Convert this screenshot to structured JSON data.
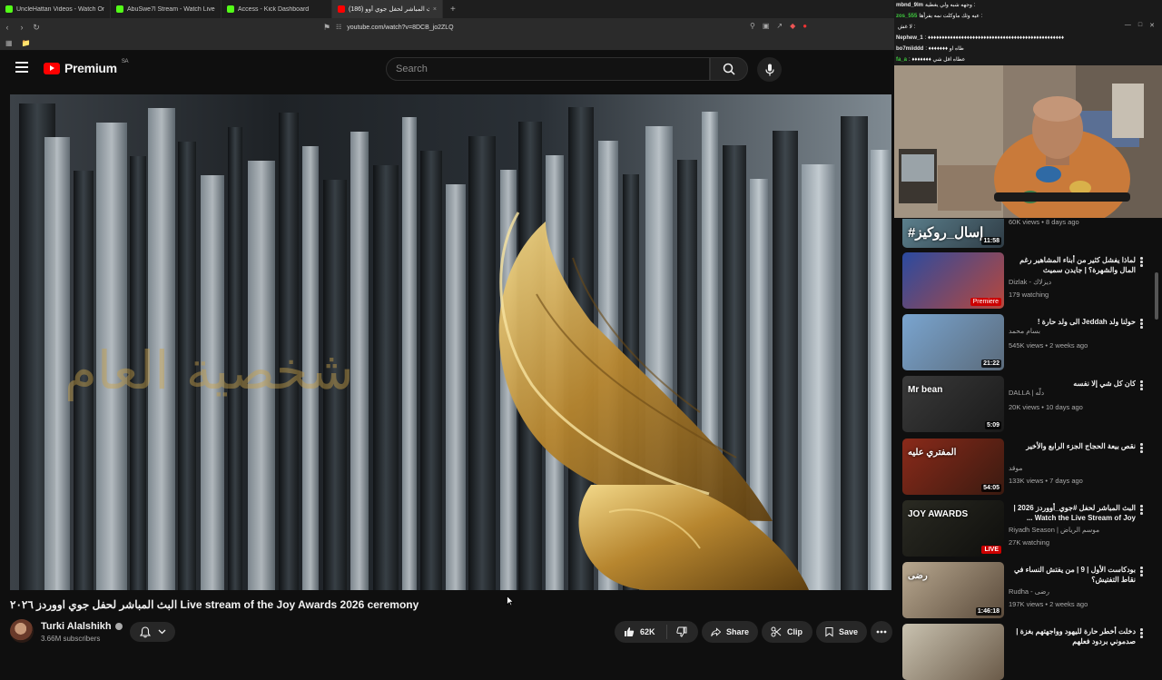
{
  "browser": {
    "tabs": [
      {
        "label": "UncleHattan Videos - Watch On",
        "icon": "kick-favicon",
        "active": false
      },
      {
        "label": "AbuSwe7l Stream - Watch Live o",
        "icon": "kick-favicon",
        "active": false
      },
      {
        "label": "Access - Kick Dashboard",
        "icon": "kick-favicon",
        "active": false
      },
      {
        "label": "(186) البث المباشر لحفل جوي أوو",
        "icon": "youtube-favicon",
        "active": true
      }
    ],
    "new_tab": "+",
    "close_glyph": "×",
    "url": "youtube.com/watch?v=8DCB_jo2ZLQ"
  },
  "youtube": {
    "logo_text": "Premium",
    "region": "SA",
    "search_placeholder": "Search"
  },
  "video": {
    "overlay_text": "شخصية العام",
    "title": "البث المباشر لحفل جوي اووردز ٢٠٢٦ Live stream of the Joy Awards 2026 ceremony",
    "channel": "Turki Alalshikh",
    "subscribers": "3.66M subscribers",
    "likes": "62K",
    "share_label": "Share",
    "clip_label": "Clip",
    "save_label": "Save"
  },
  "chat": [
    {
      "user": "mbnd_9lm",
      "user_color": "#e9e9e9",
      "text": "وجهه شبه ولي يغطية :"
    },
    {
      "user": "zos_555",
      "user_color": "#3ec93e",
      "text": "عيه وثك ماوكلت نمه يفرأها :"
    },
    {
      "user": "",
      "user_color": "#e9e9e9",
      "text": "لا غش :"
    },
    {
      "user": "Nephew_1",
      "user_color": "#e9e9e9",
      "text": ": ♦♦♦♦♦♦♦♦♦♦♦♦♦♦♦♦♦♦♦♦♦♦♦♦♦♦♦♦♦♦♦♦♦♦♦♦♦♦♦♦♦♦♦♦♦♦♦♦♦"
    },
    {
      "user": "bo7miiddd",
      "user_color": "#e9e9e9",
      "text": ": ♦♦♦♦♦♦♦ طاه او"
    },
    {
      "user": "fa_a",
      "user_color": "#3ec93e",
      "text": ": ♦♦♦♦♦♦♦ عطاه اقل شي"
    }
  ],
  "recommendations": [
    {
      "title": "",
      "channel": "",
      "meta": "60K views • 8 days ago",
      "badge": "11:58",
      "badge_type": "duration",
      "thumb_text": "#إسال_روكيز",
      "thumb_colors": [
        "#5b7f8c",
        "#2f3c45"
      ]
    },
    {
      "title": "لماذا يفشل كثير من أبناء المشاهير رغم المال والشهرة؟ | جايدن سميث",
      "channel": "Dizlak - ديزلاك",
      "meta": "179 watching",
      "badge": "Premiere",
      "badge_type": "premiere",
      "thumb_text": "",
      "thumb_colors": [
        "#2a4aa0",
        "#b8483c"
      ]
    },
    {
      "title": "حولنا ولد Jeddah الى ولد حارة !",
      "channel": "بسام محمد",
      "meta": "545K views • 2 weeks ago",
      "badge": "21:22",
      "badge_type": "duration",
      "thumb_text": "",
      "thumb_colors": [
        "#7aa5d0",
        "#5a6a7a"
      ]
    },
    {
      "title": "كان كل شي إلا نفسه",
      "channel": "DALLA | دلّه",
      "meta": "20K views • 10 days ago",
      "badge": "5:09",
      "badge_type": "duration",
      "thumb_text": "Mr bean",
      "thumb_colors": [
        "#3a3a3a",
        "#1a1a1a"
      ]
    },
    {
      "title": "نقص بيعة الحجاج الجزء الرابع والأخير",
      "channel": "موقد",
      "meta": "133K views • 7 days ago",
      "badge": "54:05",
      "badge_type": "duration",
      "thumb_text": "المفتري عليه",
      "thumb_colors": [
        "#8a2a1a",
        "#3a1a10"
      ]
    },
    {
      "title": "البث المباشر لحفل #جوي_أووردز 2026 | Watch the Live Stream of Joy ...",
      "channel": "Riyadh Season | موسم الرياض",
      "meta": "27K watching",
      "badge": "LIVE",
      "badge_type": "live",
      "thumb_text": "JOY AWARDS",
      "thumb_colors": [
        "#2a2a22",
        "#0e0e0c"
      ]
    },
    {
      "title": "بودكاست الأول | 9 | من يفتش النساء في نقاط التفتيش؟",
      "channel": "Rudha - رضى",
      "meta": "197K views • 2 weeks ago",
      "badge": "1:46:18",
      "badge_type": "duration",
      "thumb_text": "رضى",
      "thumb_colors": [
        "#b8a890",
        "#5a4a3a"
      ]
    },
    {
      "title": "دخلت أخطر حارة لليهود وواجهتهم بغزة | صدموني بردود فعلهم",
      "channel": "",
      "meta": "",
      "badge": "",
      "badge_type": "none",
      "thumb_text": "",
      "thumb_colors": [
        "#c9c2b0",
        "#6a5a48"
      ]
    }
  ],
  "colors": {
    "brand_red": "#ff0000",
    "background": "#0f0f0f",
    "pill_bg": "#272727",
    "gold": "#c9a24a"
  }
}
